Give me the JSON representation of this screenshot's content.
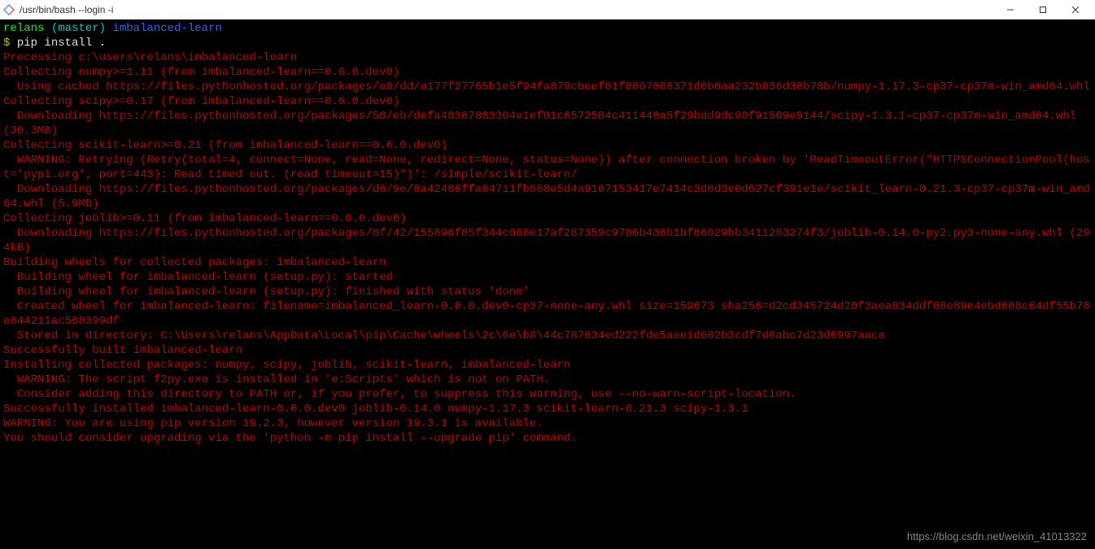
{
  "window": {
    "title": "/usr/bin/bash --login -i"
  },
  "prompt": {
    "user": "relans",
    "branch_open": "(",
    "branch": "master",
    "branch_close": ")",
    "repo": "imbalanced-learn",
    "dollar": "$",
    "command": "pip install ."
  },
  "output": {
    "l01": "Processing c:\\users\\relans\\imbalanced-learn",
    "l02": "Collecting numpy>=1.11 (from imbalanced-learn==0.6.0.dev0)",
    "l03": "  Using cached https://files.pythonhosted.org/packages/e9/dd/a177f27765b1e5f94fa879cbeef61f8807086371d0b6aa232b836d38b78b/numpy-1.17.3-cp37-cp37m-win_amd64.whl",
    "l04": "Collecting scipy>=0.17 (from imbalanced-learn==0.6.0.dev0)",
    "l05": "  Downloading https://files.pythonhosted.org/packages/50/eb/defa40367863304e1ef01c6572584c411446a5f29bdd9dc90f91509e9144/scipy-1.3.1-cp37-cp37m-win_amd64.whl (30.3MB)",
    "l06": "Collecting scikit-learn>=0.21 (from imbalanced-learn==0.6.0.dev0)",
    "l07": "  WARNING: Retrying (Retry(total=4, connect=None, read=None, redirect=None, status=None)) after connection broken by 'ReadTimeoutError(\"HTTPSConnectionPool(host='pypi.org', port=443): Read timed out. (read timeout=15)\")': /simple/scikit-learn/",
    "l08": "  Downloading https://files.pythonhosted.org/packages/d6/9e/6a42486ffa64711fb868e5d4a9167153417e7414c3d8d3e0d627cf391e1e/scikit_learn-0.21.3-cp37-cp37m-win_amd64.whl (5.9MB)",
    "l09": "Collecting joblib>=0.11 (from imbalanced-learn==0.6.0.dev0)",
    "l10": "  Downloading https://files.pythonhosted.org/packages/8f/42/155696f85f344c066e17af287359c9786b436b1bf86029bb3411283274f3/joblib-0.14.0-py2.py3-none-any.whl (294kB)",
    "l11": "Building wheels for collected packages: imbalanced-learn",
    "l12": "  Building wheel for imbalanced-learn (setup.py): started",
    "l13": "  Building wheel for imbalanced-learn (setup.py): finished with status 'done'",
    "l14": "  Created wheel for imbalanced-learn: filename=imbalanced_learn-0.6.0.dev0-cp37-none-any.whl size=159673 sha256=d2cd345724d20f3aea834ddf08e89e4ebd608c64df55b76e644211ac568399df",
    "l15": "  Stored in directory: C:\\Users\\relans\\AppData\\Local\\pip\\Cache\\wheels\\2c\\6e\\b8\\44c787634ed222fde5aee1d082b3cdf7d6abc7d23d6997aaca",
    "l16": "Successfully built imbalanced-learn",
    "l17": "Installing collected packages: numpy, scipy, joblib, scikit-learn, imbalanced-learn",
    "l18": "  WARNING: The script f2py.exe is installed in 'e:Scripts' which is not on PATH.",
    "l19": "  Consider adding this directory to PATH or, if you prefer, to suppress this warning, use --no-warn-script-location.",
    "l20": "Successfully installed imbalanced-learn-0.6.0.dev0 joblib-0.14.0 numpy-1.17.3 scikit-learn-0.21.3 scipy-1.3.1",
    "l21": "WARNING: You are using pip version 19.2.3, however version 19.3.1 is available.",
    "l22": "You should consider upgrading via the 'python -m pip install --upgrade pip' command."
  },
  "watermark": "https://blog.csdn.net/weixin_41013322"
}
